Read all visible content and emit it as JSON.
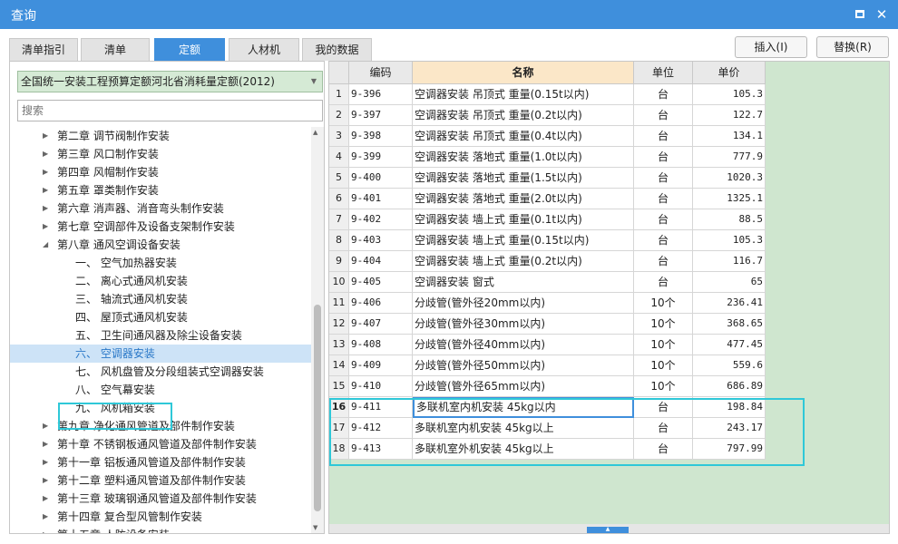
{
  "window": {
    "title": "查询"
  },
  "tabs": [
    {
      "label": "清单指引",
      "active": false
    },
    {
      "label": "清单",
      "active": false
    },
    {
      "label": "定额",
      "active": true
    },
    {
      "label": "人材机",
      "active": false
    },
    {
      "label": "我的数据",
      "active": false
    }
  ],
  "actions": {
    "insert": "插入(I)",
    "replace": "替换(R)"
  },
  "library": {
    "selected": "全国统一安装工程预算定额河北省消耗量定额(2012)"
  },
  "search": {
    "placeholder": "搜索"
  },
  "tree": [
    {
      "label": "第二章 调节阀制作安装",
      "level": 1,
      "expanded": false
    },
    {
      "label": "第三章 风口制作安装",
      "level": 1,
      "expanded": false
    },
    {
      "label": "第四章 风帽制作安装",
      "level": 1,
      "expanded": false
    },
    {
      "label": "第五章 罩类制作安装",
      "level": 1,
      "expanded": false
    },
    {
      "label": "第六章 消声器、消音弯头制作安装",
      "level": 1,
      "expanded": false
    },
    {
      "label": "第七章 空调部件及设备支架制作安装",
      "level": 1,
      "expanded": false
    },
    {
      "label": "第八章 通风空调设备安装",
      "level": 1,
      "expanded": true
    },
    {
      "label": "一、 空气加热器安装",
      "level": 2
    },
    {
      "label": "二、 离心式通风机安装",
      "level": 2
    },
    {
      "label": "三、 轴流式通风机安装",
      "level": 2
    },
    {
      "label": "四、 屋顶式通风机安装",
      "level": 2
    },
    {
      "label": "五、 卫生间通风器及除尘设备安装",
      "level": 2
    },
    {
      "label": "六、 空调器安装",
      "level": 2,
      "selected": true
    },
    {
      "label": "七、 风机盘管及分段组装式空调器安装",
      "level": 2
    },
    {
      "label": "八、 空气幕安装",
      "level": 2
    },
    {
      "label": "九、 风机箱安装",
      "level": 2
    },
    {
      "label": "第九章 净化通风管道及部件制作安装",
      "level": 1,
      "expanded": false
    },
    {
      "label": "第十章 不锈钢板通风管道及部件制作安装",
      "level": 1,
      "expanded": false
    },
    {
      "label": "第十一章 铝板通风管道及部件制作安装",
      "level": 1,
      "expanded": false
    },
    {
      "label": "第十二章 塑料通风管道及部件制作安装",
      "level": 1,
      "expanded": false
    },
    {
      "label": "第十三章 玻璃钢通风管道及部件制作安装",
      "level": 1,
      "expanded": false
    },
    {
      "label": "第十四章 复合型风管制作安装",
      "level": 1,
      "expanded": false
    },
    {
      "label": "第十五章 人防设备安装",
      "level": 1,
      "expanded": false
    }
  ],
  "grid": {
    "columns": [
      "编码",
      "名称",
      "单位",
      "单价"
    ],
    "current_row": 16,
    "rows": [
      {
        "n": "1",
        "code": "9-396",
        "name": "空调器安装 吊顶式 重量(0.15t以内)",
        "unit": "台",
        "price": "105.3"
      },
      {
        "n": "2",
        "code": "9-397",
        "name": "空调器安装 吊顶式 重量(0.2t以内)",
        "unit": "台",
        "price": "122.7"
      },
      {
        "n": "3",
        "code": "9-398",
        "name": "空调器安装 吊顶式 重量(0.4t以内)",
        "unit": "台",
        "price": "134.1"
      },
      {
        "n": "4",
        "code": "9-399",
        "name": "空调器安装 落地式 重量(1.0t以内)",
        "unit": "台",
        "price": "777.9"
      },
      {
        "n": "5",
        "code": "9-400",
        "name": "空调器安装 落地式 重量(1.5t以内)",
        "unit": "台",
        "price": "1020.3"
      },
      {
        "n": "6",
        "code": "9-401",
        "name": "空调器安装 落地式 重量(2.0t以内)",
        "unit": "台",
        "price": "1325.1"
      },
      {
        "n": "7",
        "code": "9-402",
        "name": "空调器安装 墙上式 重量(0.1t以内)",
        "unit": "台",
        "price": "88.5"
      },
      {
        "n": "8",
        "code": "9-403",
        "name": "空调器安装 墙上式 重量(0.15t以内)",
        "unit": "台",
        "price": "105.3"
      },
      {
        "n": "9",
        "code": "9-404",
        "name": "空调器安装 墙上式 重量(0.2t以内)",
        "unit": "台",
        "price": "116.7"
      },
      {
        "n": "10",
        "code": "9-405",
        "name": "空调器安装 窗式",
        "unit": "台",
        "price": "65"
      },
      {
        "n": "11",
        "code": "9-406",
        "name": "分歧管(管外径20mm以内)",
        "unit": "10个",
        "price": "236.41"
      },
      {
        "n": "12",
        "code": "9-407",
        "name": "分歧管(管外径30mm以内)",
        "unit": "10个",
        "price": "368.65"
      },
      {
        "n": "13",
        "code": "9-408",
        "name": "分歧管(管外径40mm以内)",
        "unit": "10个",
        "price": "477.45"
      },
      {
        "n": "14",
        "code": "9-409",
        "name": "分歧管(管外径50mm以内)",
        "unit": "10个",
        "price": "559.6"
      },
      {
        "n": "15",
        "code": "9-410",
        "name": "分歧管(管外径65mm以内)",
        "unit": "10个",
        "price": "686.89"
      },
      {
        "n": "16",
        "code": "9-411",
        "name": "多联机室内机安装 45kg以内",
        "unit": "台",
        "price": "198.84"
      },
      {
        "n": "17",
        "code": "9-412",
        "name": "多联机室内机安装 45kg以上",
        "unit": "台",
        "price": "243.17"
      },
      {
        "n": "18",
        "code": "9-413",
        "name": "多联机室外机安装 45kg以上",
        "unit": "台",
        "price": "797.99"
      }
    ]
  },
  "colors": {
    "accent": "#3f8fdc",
    "highlight": "#2fc8d8",
    "grid_background": "#cfe6cf"
  }
}
